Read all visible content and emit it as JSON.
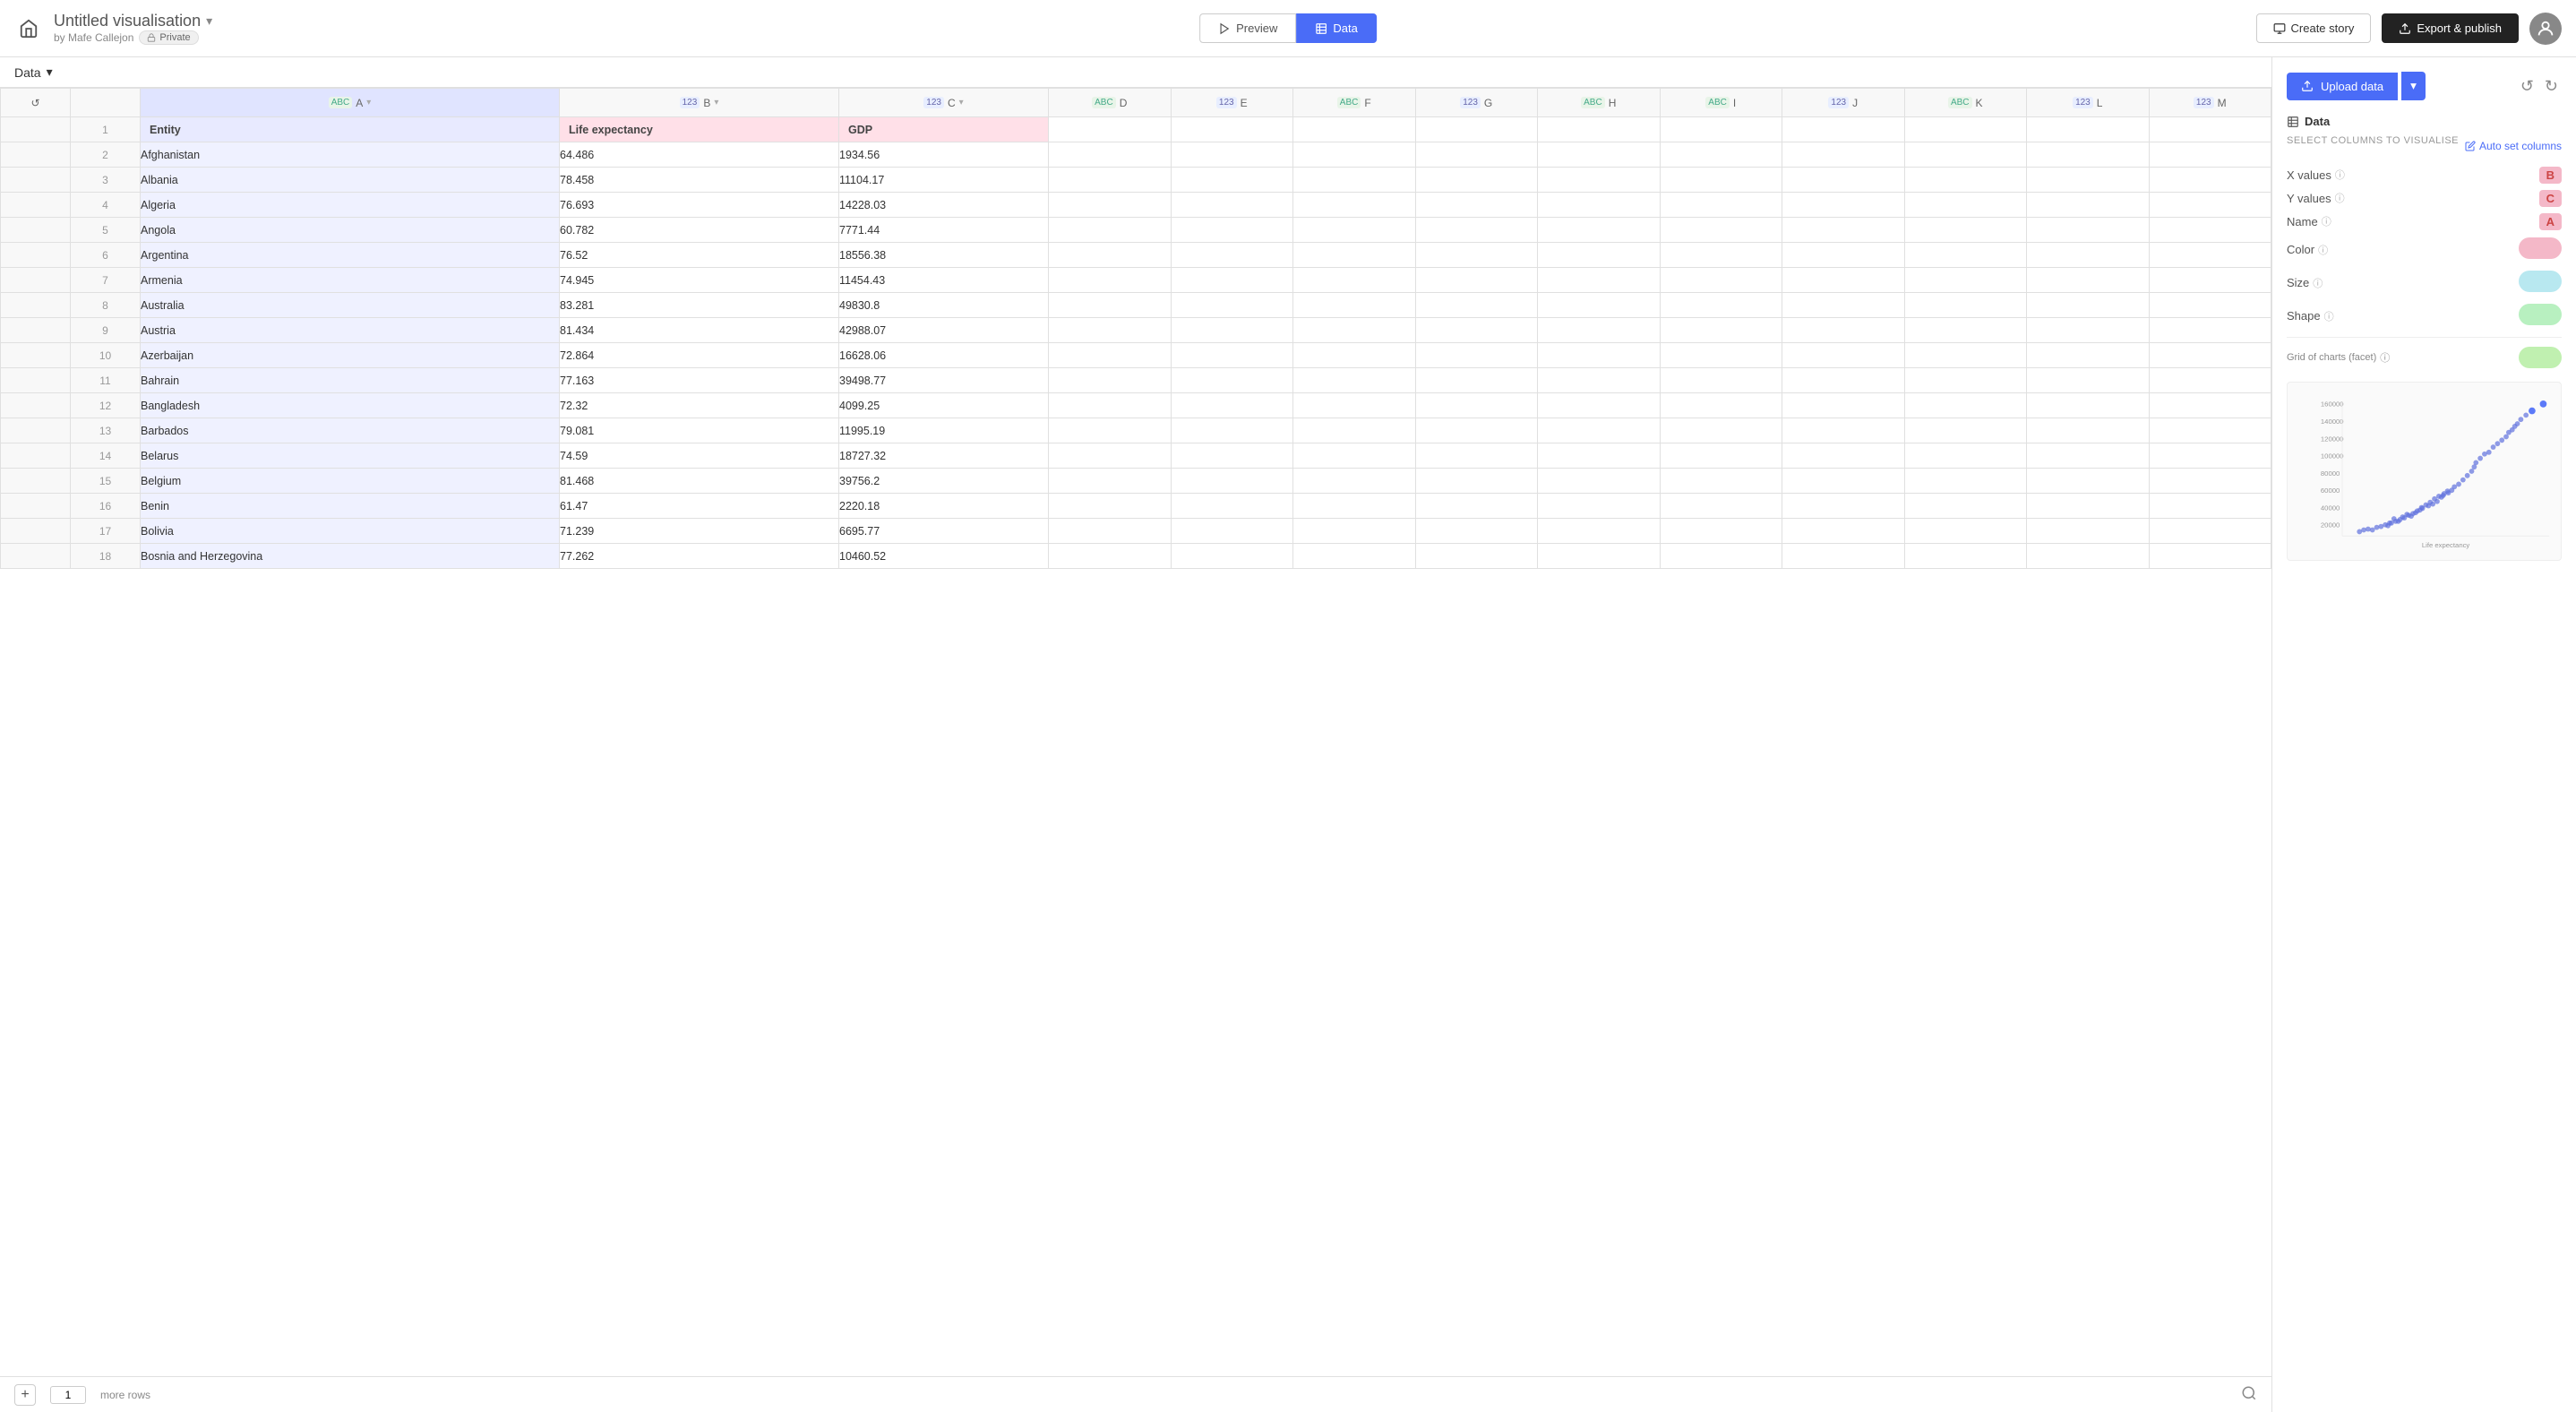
{
  "topbar": {
    "title": "Untitled visualisation",
    "subtitle": "by Mafe Callejon",
    "privacy": "Private",
    "tabs": [
      {
        "id": "preview",
        "label": "Preview",
        "active": false
      },
      {
        "id": "data",
        "label": "Data",
        "active": true
      }
    ],
    "create_story_label": "Create story",
    "export_label": "Export & publish"
  },
  "data_bar": {
    "label": "Data",
    "chevron": "▾"
  },
  "columns": [
    {
      "id": "A",
      "type": "ABC",
      "name": "Entity",
      "selected": true
    },
    {
      "id": "B",
      "type": "123",
      "name": "Life expectancy",
      "selected": false
    },
    {
      "id": "C",
      "type": "123",
      "name": "GDP",
      "selected": false
    },
    {
      "id": "D",
      "type": "ABC",
      "name": "",
      "selected": false
    },
    {
      "id": "E",
      "type": "123",
      "name": "",
      "selected": false
    },
    {
      "id": "F",
      "type": "ABC",
      "name": "",
      "selected": false
    },
    {
      "id": "G",
      "type": "123",
      "name": "",
      "selected": false
    },
    {
      "id": "H",
      "type": "ABC",
      "name": "",
      "selected": false
    },
    {
      "id": "I",
      "type": "ABC",
      "name": "",
      "selected": false
    },
    {
      "id": "J",
      "type": "123",
      "name": "",
      "selected": false
    },
    {
      "id": "K",
      "type": "ABC",
      "name": "",
      "selected": false
    },
    {
      "id": "L",
      "type": "123",
      "name": "",
      "selected": false
    },
    {
      "id": "M",
      "type": "123",
      "name": "",
      "selected": false
    }
  ],
  "rows": [
    {
      "num": 1,
      "A": "Entity",
      "B": "Life expectancy",
      "C": "GDP",
      "is_header": true
    },
    {
      "num": 2,
      "A": "Afghanistan",
      "B": "64.486",
      "C": "1934.56"
    },
    {
      "num": 3,
      "A": "Albania",
      "B": "78.458",
      "C": "11104.17"
    },
    {
      "num": 4,
      "A": "Algeria",
      "B": "76.693",
      "C": "14228.03"
    },
    {
      "num": 5,
      "A": "Angola",
      "B": "60.782",
      "C": "7771.44"
    },
    {
      "num": 6,
      "A": "Argentina",
      "B": "76.52",
      "C": "18556.38"
    },
    {
      "num": 7,
      "A": "Armenia",
      "B": "74.945",
      "C": "11454.43"
    },
    {
      "num": 8,
      "A": "Australia",
      "B": "83.281",
      "C": "49830.8"
    },
    {
      "num": 9,
      "A": "Austria",
      "B": "81.434",
      "C": "42988.07"
    },
    {
      "num": 10,
      "A": "Azerbaijan",
      "B": "72.864",
      "C": "16628.06"
    },
    {
      "num": 11,
      "A": "Bahrain",
      "B": "77.163",
      "C": "39498.77"
    },
    {
      "num": 12,
      "A": "Bangladesh",
      "B": "72.32",
      "C": "4099.25"
    },
    {
      "num": 13,
      "A": "Barbados",
      "B": "79.081",
      "C": "11995.19"
    },
    {
      "num": 14,
      "A": "Belarus",
      "B": "74.59",
      "C": "18727.32"
    },
    {
      "num": 15,
      "A": "Belgium",
      "B": "81.468",
      "C": "39756.2"
    },
    {
      "num": 16,
      "A": "Benin",
      "B": "61.47",
      "C": "2220.18"
    },
    {
      "num": 17,
      "A": "Bolivia",
      "B": "71.239",
      "C": "6695.77"
    },
    {
      "num": 18,
      "A": "Bosnia and Herzegovina",
      "B": "77.262",
      "C": "10460.52"
    }
  ],
  "bottom_bar": {
    "add_row": "+",
    "row_count": "1",
    "more_rows": "more rows"
  },
  "right_panel": {
    "upload_label": "Upload data",
    "section_title": "Data",
    "select_columns_label": "SELECT COLUMNS TO VISUALISE",
    "auto_set_label": "Auto set columns",
    "fields": [
      {
        "id": "x_values",
        "label": "X values",
        "info": true,
        "value": "B"
      },
      {
        "id": "y_values",
        "label": "Y values",
        "info": true,
        "value": "C"
      },
      {
        "id": "name",
        "label": "Name",
        "info": true,
        "value": "A"
      },
      {
        "id": "color",
        "label": "Color",
        "info": true,
        "value": "color"
      },
      {
        "id": "size",
        "label": "Size",
        "info": true,
        "value": "size"
      },
      {
        "id": "shape",
        "label": "Shape",
        "info": true,
        "value": "shape"
      }
    ],
    "grid_facet_label": "Grid of charts (facet)",
    "undo_label": "↺",
    "redo_label": "↻"
  }
}
